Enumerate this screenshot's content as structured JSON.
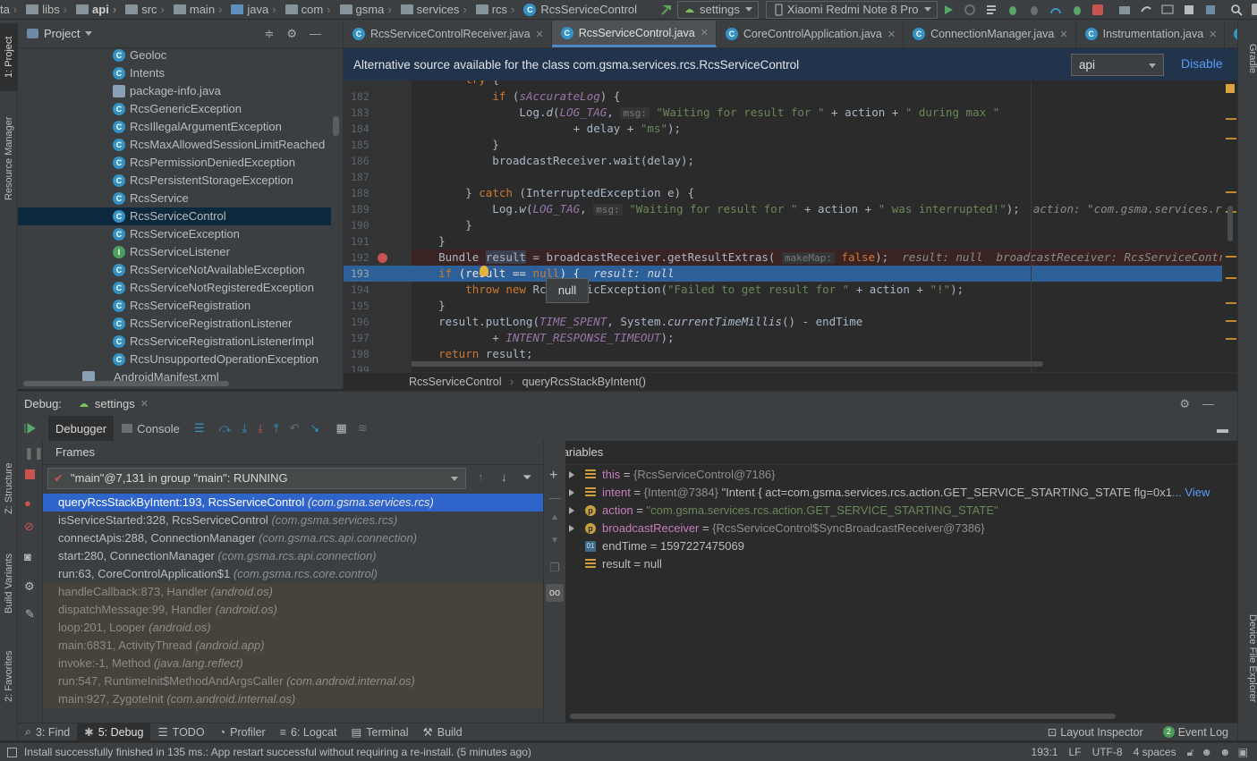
{
  "navbar": {
    "crumbs": [
      "ta",
      "libs",
      "api",
      "src",
      "main",
      "java",
      "com",
      "gsma",
      "services",
      "rcs"
    ],
    "current_class": "RcsServiceControl",
    "run_config": "settings",
    "device": "Xiaomi Redmi Note 8 Pro"
  },
  "left_stripe": {
    "project": "1: Project",
    "resource_manager": "Resource Manager",
    "structure": "Z: Structure",
    "build_variants": "Build Variants",
    "favorites": "2: Favorites"
  },
  "right_stripe": {
    "gradle": "Gradle",
    "device_file_explorer": "Device File Explorer"
  },
  "project": {
    "title": "Project",
    "items": [
      {
        "name": "Geoloc",
        "kind": "class"
      },
      {
        "name": "Intents",
        "kind": "class"
      },
      {
        "name": "package-info.java",
        "kind": "file"
      },
      {
        "name": "RcsGenericException",
        "kind": "class"
      },
      {
        "name": "RcsIllegalArgumentException",
        "kind": "class"
      },
      {
        "name": "RcsMaxAllowedSessionLimitReached",
        "kind": "class"
      },
      {
        "name": "RcsPermissionDeniedException",
        "kind": "class"
      },
      {
        "name": "RcsPersistentStorageException",
        "kind": "class"
      },
      {
        "name": "RcsService",
        "kind": "abstract"
      },
      {
        "name": "RcsServiceControl",
        "kind": "class"
      },
      {
        "name": "RcsServiceException",
        "kind": "class"
      },
      {
        "name": "RcsServiceListener",
        "kind": "interface"
      },
      {
        "name": "RcsServiceNotAvailableException",
        "kind": "class"
      },
      {
        "name": "RcsServiceNotRegisteredException",
        "kind": "class"
      },
      {
        "name": "RcsServiceRegistration",
        "kind": "class"
      },
      {
        "name": "RcsServiceRegistrationListener",
        "kind": "abstract"
      },
      {
        "name": "RcsServiceRegistrationListenerImpl",
        "kind": "class"
      },
      {
        "name": "RcsUnsupportedOperationException",
        "kind": "class"
      },
      {
        "name": "AndroidManifest.xml",
        "kind": "file"
      }
    ],
    "selected": "RcsServiceControl"
  },
  "editor_tabs": [
    {
      "label": "RcsServiceControlReceiver.java",
      "active": false
    },
    {
      "label": "RcsServiceControl.java",
      "active": true
    },
    {
      "label": "CoreControlApplication.java",
      "active": false
    },
    {
      "label": "ConnectionManager.java",
      "active": false
    },
    {
      "label": "Instrumentation.java",
      "active": false
    },
    {
      "label": "Co",
      "active": false
    }
  ],
  "tabs_overflow": "5",
  "banner": {
    "text": "Alternative source available for the class com.gsma.services.rcs.RcsServiceControl",
    "select_value": "api",
    "disable": "Disable"
  },
  "code": {
    "line_numbers": [
      "182",
      "183",
      "184",
      "185",
      "186",
      "187",
      "188",
      "189",
      "190",
      "191",
      "192",
      "193",
      "194",
      "195",
      "196",
      "197",
      "198",
      "199"
    ],
    "current_line": "193"
  },
  "tooltip": "null",
  "code_breadcrumb": [
    "RcsServiceControl",
    "queryRcsStackByIntent()"
  ],
  "debug": {
    "label": "Debug:",
    "session": "settings",
    "debugger_tab": "Debugger",
    "console_tab": "Console",
    "frames_title": "Frames",
    "variables_title": "Variables",
    "thread": "\"main\"@7,131 in group \"main\": RUNNING",
    "frames": [
      {
        "m": "queryRcsStackByIntent:193, RcsServiceControl",
        "p": "(com.gsma.services.rcs)",
        "lib": false,
        "sel": true
      },
      {
        "m": "isServiceStarted:328, RcsServiceControl",
        "p": "(com.gsma.services.rcs)",
        "lib": false
      },
      {
        "m": "connectApis:288, ConnectionManager",
        "p": "(com.gsma.rcs.api.connection)",
        "lib": false
      },
      {
        "m": "start:280, ConnectionManager",
        "p": "(com.gsma.rcs.api.connection)",
        "lib": false
      },
      {
        "m": "run:63, CoreControlApplication$1",
        "p": "(com.gsma.rcs.core.control)",
        "lib": false
      },
      {
        "m": "handleCallback:873, Handler",
        "p": "(android.os)",
        "lib": true
      },
      {
        "m": "dispatchMessage:99, Handler",
        "p": "(android.os)",
        "lib": true
      },
      {
        "m": "loop:201, Looper",
        "p": "(android.os)",
        "lib": true
      },
      {
        "m": "main:6831, ActivityThread",
        "p": "(android.app)",
        "lib": true
      },
      {
        "m": "invoke:-1, Method",
        "p": "(java.lang.reflect)",
        "lib": true
      },
      {
        "m": "run:547, RuntimeInit$MethodAndArgsCaller",
        "p": "(com.android.internal.os)",
        "lib": true
      },
      {
        "m": "main:927, ZygoteInit",
        "p": "(com.android.internal.os)",
        "lib": true
      }
    ],
    "variables": [
      {
        "name": "this",
        "eq": " = ",
        "type": "{RcsServiceControl@7186}",
        "val": "",
        "exp": true,
        "icon": "field"
      },
      {
        "name": "intent",
        "eq": " = ",
        "type": "{Intent@7384}",
        "val": " \"Intent { act=com.gsma.services.rcs.action.GET_SERVICE_STARTING_STATE flg=0x1",
        "link": "... View",
        "exp": true,
        "icon": "field"
      },
      {
        "name": "action",
        "eq": " = ",
        "type": "",
        "val": "\"com.gsma.services.rcs.action.GET_SERVICE_STARTING_STATE\"",
        "exp": true,
        "icon": "param",
        "str": true
      },
      {
        "name": "broadcastReceiver",
        "eq": " = ",
        "type": "{RcsServiceControl$SyncBroadcastReceiver@7386}",
        "val": "",
        "exp": true,
        "icon": "param"
      },
      {
        "name": "endTime",
        "eq": " = ",
        "type": "",
        "val": "1597227475069",
        "exp": false,
        "icon": "prim",
        "plain": true
      },
      {
        "name": "result",
        "eq": " = ",
        "type": "",
        "val": "null",
        "exp": false,
        "icon": "field",
        "plain": true
      }
    ]
  },
  "bottom_tabs": [
    {
      "label": "3: Find",
      "active": false
    },
    {
      "label": "5: Debug",
      "active": true
    },
    {
      "label": "TODO",
      "active": false
    },
    {
      "label": "Profiler",
      "active": false
    },
    {
      "label": "6: Logcat",
      "active": false
    },
    {
      "label": "Terminal",
      "active": false
    },
    {
      "label": "Build",
      "active": false
    }
  ],
  "bottom_right": {
    "layout_inspector": "Layout Inspector",
    "event_log": "Event Log",
    "event_count": "2"
  },
  "status": {
    "message": "Install successfully finished in 135 ms.: App restart successful without requiring a re-install. (5 minutes ago)",
    "position": "193:1",
    "line_sep": "LF",
    "encoding": "UTF-8",
    "indent": "4 spaces"
  },
  "colors": {
    "accent": "#2f65ca",
    "banner": "#21344c",
    "exec_line": "#2d6099",
    "keyword": "#cc7832",
    "string": "#6a8759"
  }
}
